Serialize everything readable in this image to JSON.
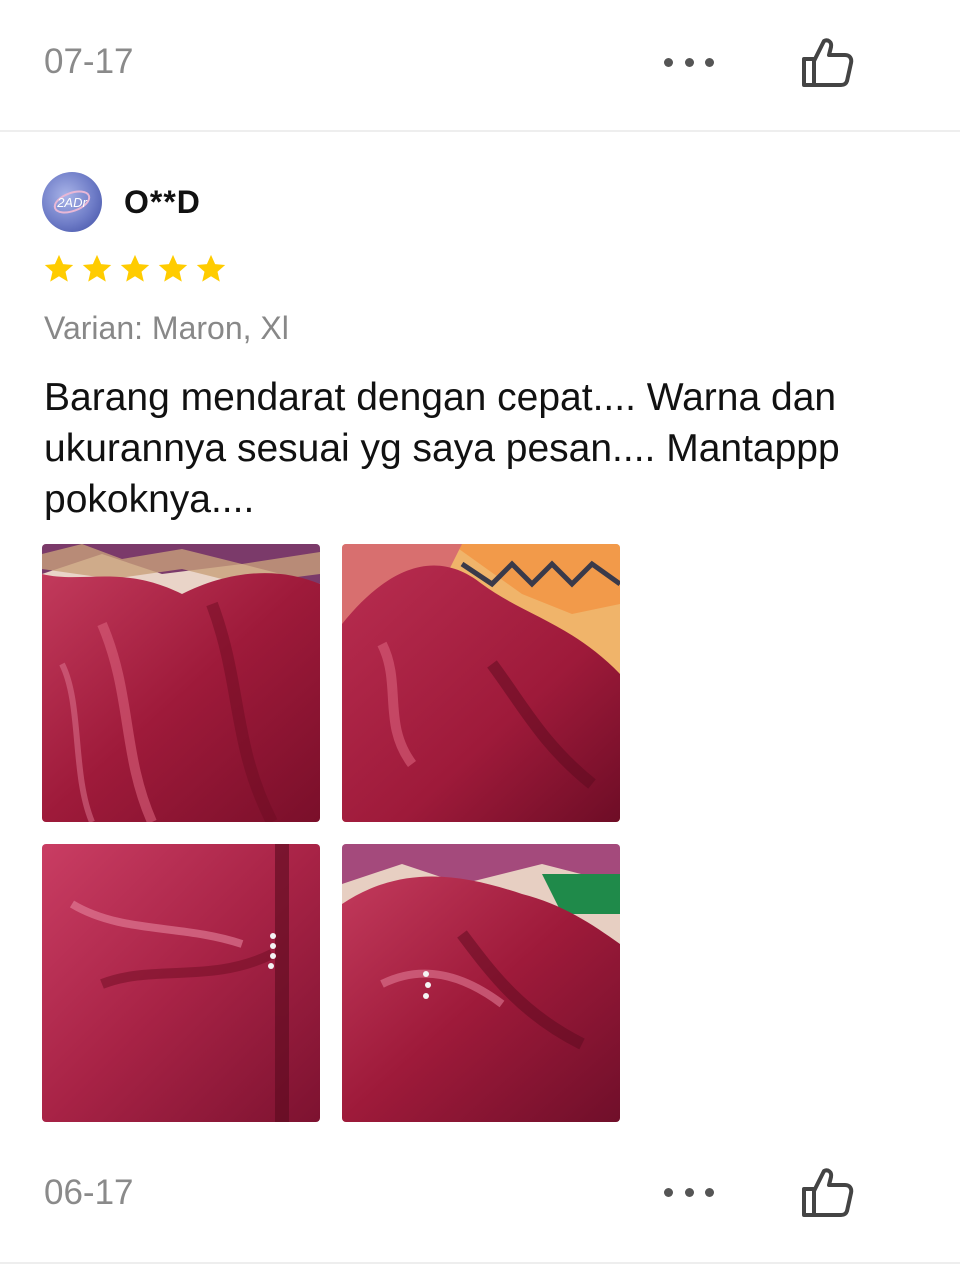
{
  "previous_review": {
    "date": "07-17",
    "more_icon": "more-horizontal-icon",
    "like_icon": "thumbs-up-icon"
  },
  "review": {
    "user": {
      "avatar_icon": "user-avatar",
      "name": "O**D"
    },
    "rating": 5,
    "star_color": "#FFCC00",
    "variant": "Varian: Maron, Xl",
    "text": "Barang mendarat dengan cepat.... Warna dan ukurannya sesuai yg saya pesan.... Mantappp pokoknya....",
    "photos": [
      {
        "id": "photo-1"
      },
      {
        "id": "photo-2"
      },
      {
        "id": "photo-3"
      },
      {
        "id": "photo-4"
      }
    ],
    "date": "06-17",
    "more_icon": "more-horizontal-icon",
    "like_icon": "thumbs-up-icon"
  },
  "colors": {
    "fabric": "#9e1a3a",
    "text_muted": "#8a8a8a",
    "divider": "#eeeeee"
  }
}
